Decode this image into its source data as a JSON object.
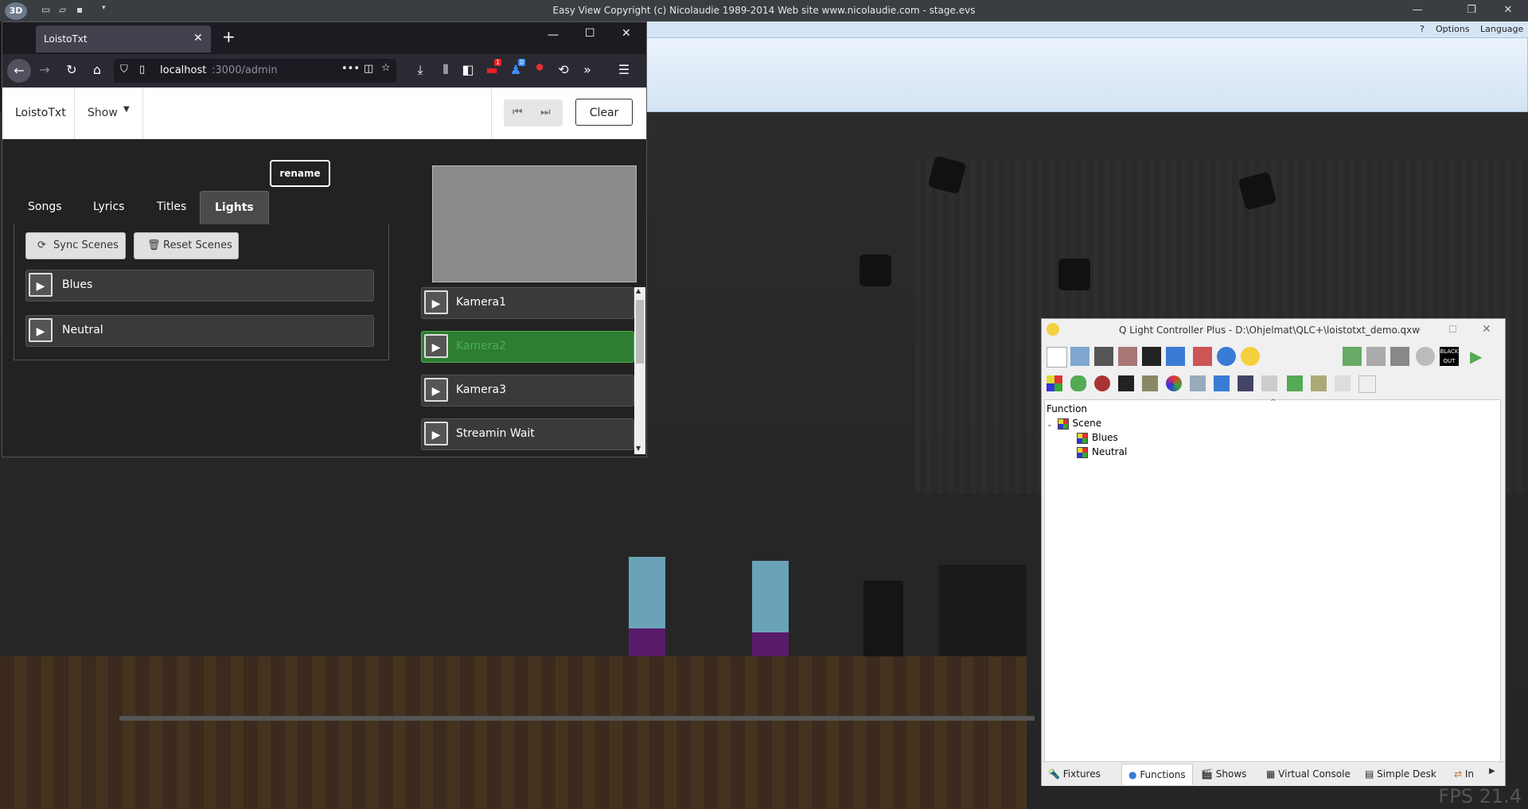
{
  "easyview": {
    "caption": "Easy View   Copyright (c) Nicolaudie 1989-2014    Web site www.nicolaudie.com - stage.evs",
    "logo": "3D",
    "ribbon_menu": {
      "help": "?",
      "options": "Options",
      "language": "Language"
    },
    "fps": "FPS 21.4"
  },
  "browser": {
    "tab_title": "LoistoTxt",
    "url_host": "localhost",
    "url_path": ":3000/admin",
    "badges": {
      "todo": "1",
      "notify": "0"
    }
  },
  "app": {
    "brand": "LoistoTxt",
    "show_menu": "Show",
    "clear_button": "Clear",
    "rename_button": "rename",
    "tabs": [
      {
        "label": "Songs",
        "active": false
      },
      {
        "label": "Lyrics",
        "active": false
      },
      {
        "label": "Titles",
        "active": false
      },
      {
        "label": "Lights",
        "active": true
      }
    ],
    "sync_scenes": "Sync Scenes",
    "reset_scenes": "Reset Scenes",
    "scenes": [
      "Blues",
      "Neutral"
    ],
    "cameras": [
      {
        "label": "Kamera1",
        "active": false
      },
      {
        "label": "Kamera2",
        "active": true
      },
      {
        "label": "Kamera3",
        "active": false
      },
      {
        "label": "Streamin Wait",
        "active": false
      }
    ]
  },
  "qlc": {
    "title": "Q Light Controller Plus - D:\\Ohjelmat\\QLC+\\loistotxt_demo.qxw",
    "blackout_label": "BLACK OUT",
    "tree_header": "Function",
    "tree": {
      "group": "Scene",
      "items": [
        "Blues",
        "Neutral"
      ]
    },
    "bottom_tabs": [
      "Fixtures",
      "Functions",
      "Shows",
      "Virtual Console",
      "Simple Desk",
      "In"
    ]
  },
  "colors": {
    "active_green": "#2e7d32",
    "active_text": "#4caf50"
  }
}
